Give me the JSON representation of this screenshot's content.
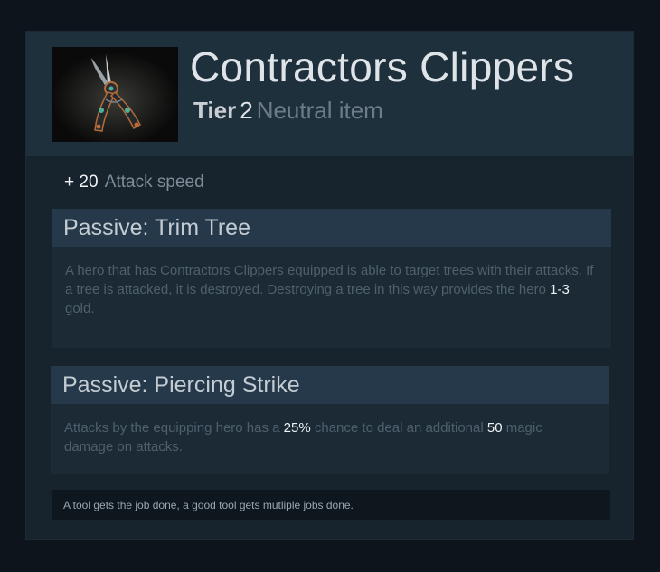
{
  "item": {
    "name": "Contractors Clippers",
    "tier_label": "Tier",
    "tier_number": "2",
    "type": "Neutral item",
    "icon": "pruning-shears-icon"
  },
  "stat": {
    "value": "+ 20",
    "name": "Attack speed"
  },
  "abilities": [
    {
      "title": "Passive: Trim Tree",
      "text_1": "A hero that has Contractors Clippers equipped is able to target trees with their attacks. If a tree is attacked, it is destroyed. Destroying a tree in this way provides the hero ",
      "highlight_1": "1-3",
      "text_2": " gold."
    },
    {
      "title": "Passive: Piercing Strike",
      "text_1": "Attacks by the equipping hero has a ",
      "highlight_1": "25%",
      "text_2": " chance to deal an additional ",
      "highlight_2": "50",
      "text_3": " magic damage on attacks."
    }
  ],
  "lore": "A tool gets the job done, a good tool gets mutliple jobs done.",
  "colors": {
    "page_bg": "#0d141c",
    "card_bg": "#17232d",
    "header_bg": "#1f303d",
    "ability_head_bg": "#26394a",
    "highlight": "#f0f3f6"
  }
}
